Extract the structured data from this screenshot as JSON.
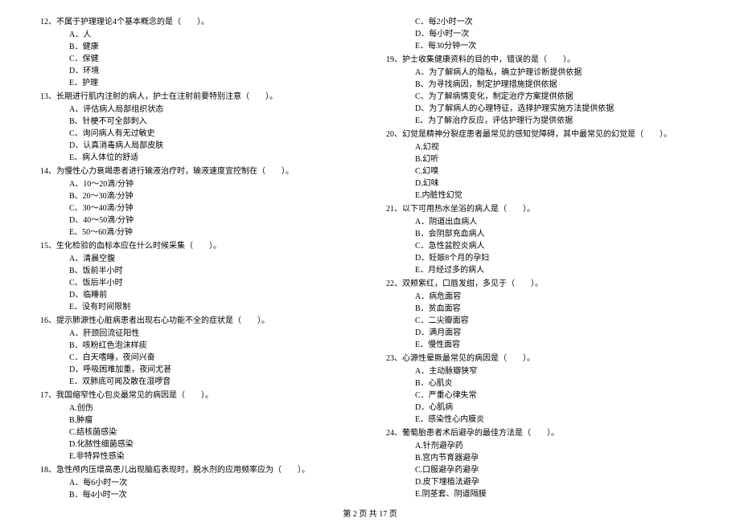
{
  "left_column": [
    {
      "num": "12",
      "text": "不属于护理理论4个基本概念的是（　　）。",
      "options": [
        "A．人",
        "B．健康",
        "C．保健",
        "D．环境",
        "E．护理"
      ]
    },
    {
      "num": "13",
      "text": "长期进行肌内注射的病人，护士在注射前要特别注意（　　）。",
      "options": [
        "A、评估病人局部组织状态",
        "B、针梗不可全部刺入",
        "C、询问病人有无过敏史",
        "D、认真消毒病人局部皮肤",
        "E、病人体位的舒适"
      ]
    },
    {
      "num": "14",
      "text": "为慢性心力衰竭患者进行输液治疗时，输液速度宜控制在（　　）。",
      "options": [
        "A、10～20滴/分钟",
        "B、20～30滴/分钟",
        "C、30～40滴/分钟",
        "D、40～50滴/分钟",
        "E、50～60滴/分钟"
      ]
    },
    {
      "num": "15",
      "text": "生化检验的血标本应在什么时候采集（　　）。",
      "options": [
        "A、清晨空腹",
        "B、饭前半小时",
        "C、饭后半小时",
        "D、临睡前",
        "E、没有时间限制"
      ]
    },
    {
      "num": "16",
      "text": "提示肺源性心脏病患者出现右心功能不全的症状是（　　）。",
      "options": [
        "A．肝颈回流征阳性",
        "B．咳粉红色泡沫样痰",
        "C．白天嗜睡，夜间兴奋",
        "D．呼吸困难加重，夜间尤甚",
        "E．双肺底可闻及散在湿啰音"
      ]
    },
    {
      "num": "17",
      "text": "我国缩窄性心包炎最常见的病因是（　　）。",
      "options": [
        "A.创伤",
        "B.肿瘤",
        "C.结核菌感染",
        "D.化脓性细菌感染",
        "E.非特异性感染"
      ]
    },
    {
      "num": "18",
      "text": "急性颅内压增高患儿出现脑疝表现时，脱水剂的应用频率应为（　　）。",
      "options": [
        "A．每6小时一次",
        "B．每4小时一次"
      ]
    }
  ],
  "right_column_continue": [
    "C．每2小时一次",
    "D．每小时一次",
    "E．每30分钟一次"
  ],
  "right_column": [
    {
      "num": "19",
      "text": "护士收集健康资料的目的中，错误的是（　　）。",
      "options": [
        "A、为了解病人的隐私，确立护理诊断提供依据",
        "B、为寻找病因，制定护理措施提供依据",
        "C、为了解病情变化，制定治疗方案提供依据",
        "D、为了解病人的心理特征，选择护理实施方法提供依据",
        "E、为了解治疗反应，评估护理行为提供依据"
      ]
    },
    {
      "num": "20",
      "text": "幻觉是精神分裂症患者最常见的感知觉障碍，其中最常见的幻觉是（　　）。",
      "options": [
        "A.幻视",
        "B.幻听",
        "C.幻嗅",
        "D.幻味",
        "E.内脏性幻觉"
      ]
    },
    {
      "num": "21",
      "text": "以下可用热水坐浴的病人是（　　）。",
      "options": [
        "A．阴道出血病人",
        "B．会阴部充血病人",
        "C．急性盆腔炎病人",
        "D．妊娠8个月的孕妇",
        "E．月经过多的病人"
      ]
    },
    {
      "num": "22",
      "text": "双颊紫红，口唇发绀，多见于（　　）。",
      "options": [
        "A．病危面容",
        "B．贫血面容",
        "C．二尖瓣面容",
        "D．满月面容",
        "E．慢性面容"
      ]
    },
    {
      "num": "23",
      "text": "心源性晕厥最常见的病因是（　　）。",
      "options": [
        "A．主动脉瓣狭窄",
        "B．心肌炎",
        "C．严重心律失常",
        "D．心肌病",
        "E．感染性心内膜炎"
      ]
    },
    {
      "num": "24",
      "text": "葡萄胎患者术后避孕的最佳方法是（　　）。",
      "options": [
        "A.针剂避孕药",
        "B.宫内节育器避孕",
        "C.口服避孕药避孕",
        "D.皮下埋植法避孕",
        "E.阴茎套、阴道隔膜"
      ]
    }
  ],
  "footer": "第 2 页 共 17 页"
}
